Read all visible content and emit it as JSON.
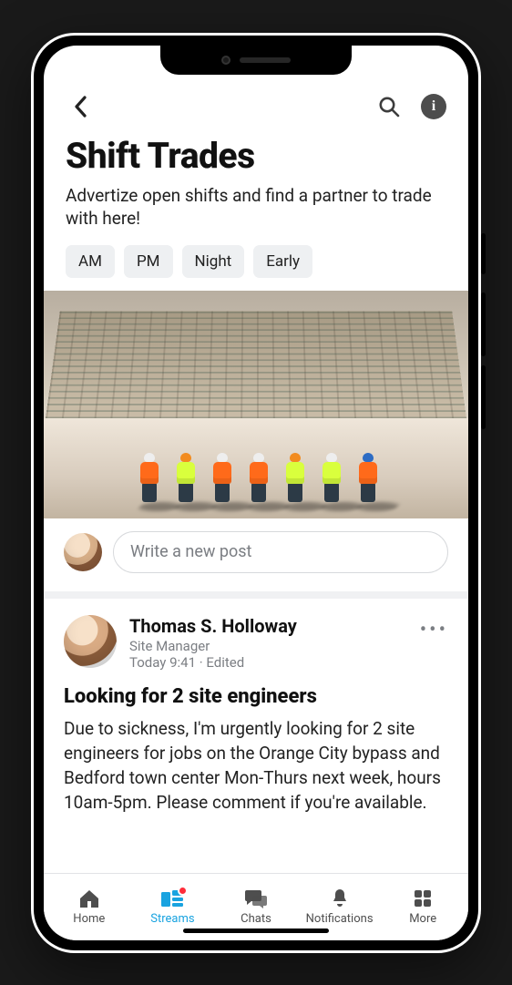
{
  "header": {
    "title": "Shift Trades",
    "subtitle": "Advertize open shifts and find a partner to trade with here!"
  },
  "chips": [
    "AM",
    "PM",
    "Night",
    "Early"
  ],
  "compose": {
    "placeholder": "Write a new post"
  },
  "post": {
    "author": "Thomas S. Holloway",
    "role": "Site Manager",
    "timestamp": "Today 9:41 · Edited",
    "title": "Looking for 2 site engineers",
    "body": "Due to sickness, I'm urgently looking for 2 site engineers for jobs on the Orange City bypass and Bedford town center Mon-Thurs next week, hours 10am-5pm. Please comment if you're available."
  },
  "tabs": {
    "home": "Home",
    "streams": "Streams",
    "chats": "Chats",
    "notifications": "Notifications",
    "more": "More",
    "active": "streams",
    "streams_badge": true
  },
  "icons": {
    "back": "chevron-left-icon",
    "search": "search-icon",
    "info": "info-icon",
    "more": "more-horizontal-icon"
  }
}
